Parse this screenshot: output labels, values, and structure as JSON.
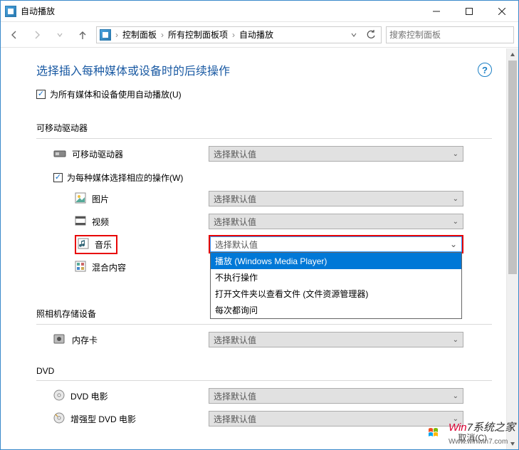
{
  "window": {
    "title": "自动播放"
  },
  "nav": {
    "back": "后退",
    "forward": "前进",
    "up": "上一级"
  },
  "breadcrumbs": {
    "a": "控制面板",
    "b": "所有控制面板项",
    "c": "自动播放"
  },
  "search": {
    "placeholder": "搜索控制面板"
  },
  "main": {
    "heading": "选择插入每种媒体或设备时的后续操作",
    "all_media_checkbox": "为所有媒体和设备使用自动播放(U)",
    "default_text": "选择默认值",
    "sections": {
      "removable": {
        "title": "可移动驱动器",
        "drive": "可移动驱动器",
        "per_media_checkbox": "为每种媒体选择相应的操作(W)",
        "pictures": "图片",
        "videos": "视频",
        "music": "音乐",
        "mixed": "混合内容"
      },
      "camera": {
        "title": "照相机存储设备",
        "memory_card": "内存卡"
      },
      "dvd": {
        "title": "DVD",
        "movie": "DVD 电影",
        "enhanced": "增强型 DVD 电影"
      }
    },
    "dropdown": {
      "current": "选择默认值",
      "options": [
        "播放 (Windows Media Player)",
        "不执行操作",
        "打开文件夹以查看文件 (文件资源管理器)",
        "每次都询问"
      ]
    }
  },
  "footer": {
    "cancel": "取消(C)"
  },
  "watermark": {
    "text": "7系统之家",
    "prefix": "Win",
    "url": "Www.winwin7.com"
  }
}
